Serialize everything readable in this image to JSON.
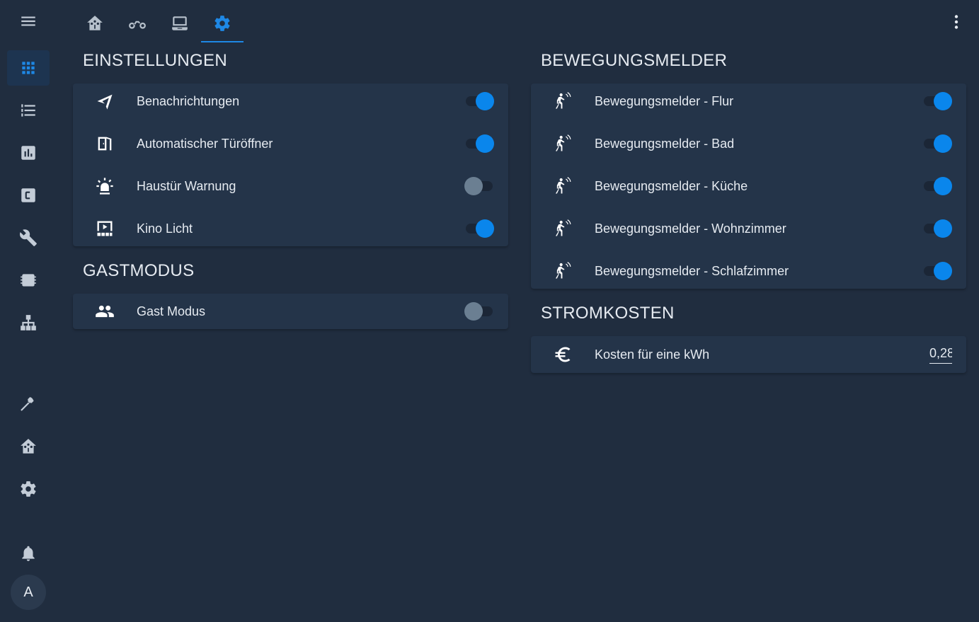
{
  "sidebar": {
    "items": [
      {
        "name": "menu-icon"
      },
      {
        "name": "overview-grid-icon"
      },
      {
        "name": "logbook-list-icon"
      },
      {
        "name": "history-chart-icon"
      },
      {
        "name": "hacs-icon"
      },
      {
        "name": "wrench-icon"
      },
      {
        "name": "chip-icon"
      },
      {
        "name": "network-icon"
      },
      {
        "name": "hammer-icon"
      },
      {
        "name": "home-assistant-icon"
      },
      {
        "name": "gear-icon"
      },
      {
        "name": "bell-icon"
      }
    ],
    "avatar_initial": "A"
  },
  "tabs": [
    {
      "name": "home-tab-icon"
    },
    {
      "name": "motorbike-tab-icon"
    },
    {
      "name": "laptop-tab-icon"
    },
    {
      "name": "settings-tab-icon",
      "active": true
    }
  ],
  "colors": {
    "accent": "#1e88e5",
    "background": "#202d3f",
    "card": "#243449"
  },
  "einstellungen": {
    "title": "EINSTELLUNGEN",
    "rows": [
      {
        "label": "Benachrichtungen",
        "icon": "send-icon",
        "state": "on"
      },
      {
        "label": "Automatischer Türöffner",
        "icon": "door-icon",
        "state": "on"
      },
      {
        "label": "Haustür Warnung",
        "icon": "alarm-light-icon",
        "state": "off"
      },
      {
        "label": "Kino Licht",
        "icon": "theater-icon",
        "state": "on"
      }
    ]
  },
  "gastmodus": {
    "title": "GASTMODUS",
    "rows": [
      {
        "label": "Gast Modus",
        "icon": "account-group-icon",
        "state": "off"
      }
    ]
  },
  "bewegungsmelder": {
    "title": "BEWEGUNGSMELDER",
    "rows": [
      {
        "label": "Bewegungsmelder - Flur",
        "icon": "motion-sensor-icon",
        "state": "on"
      },
      {
        "label": "Bewegungsmelder - Bad",
        "icon": "motion-sensor-icon",
        "state": "on"
      },
      {
        "label": "Bewegungsmelder - Küche",
        "icon": "motion-sensor-icon",
        "state": "on"
      },
      {
        "label": "Bewegungsmelder - Wohnzimmer",
        "icon": "motion-sensor-icon",
        "state": "on"
      },
      {
        "label": "Bewegungsmelder - Schlafzimmer",
        "icon": "motion-sensor-icon",
        "state": "on"
      }
    ]
  },
  "stromkosten": {
    "title": "STROMKOSTEN",
    "rows": [
      {
        "label": "Kosten für eine kWh",
        "icon": "euro-icon",
        "value": "0,28"
      }
    ]
  }
}
